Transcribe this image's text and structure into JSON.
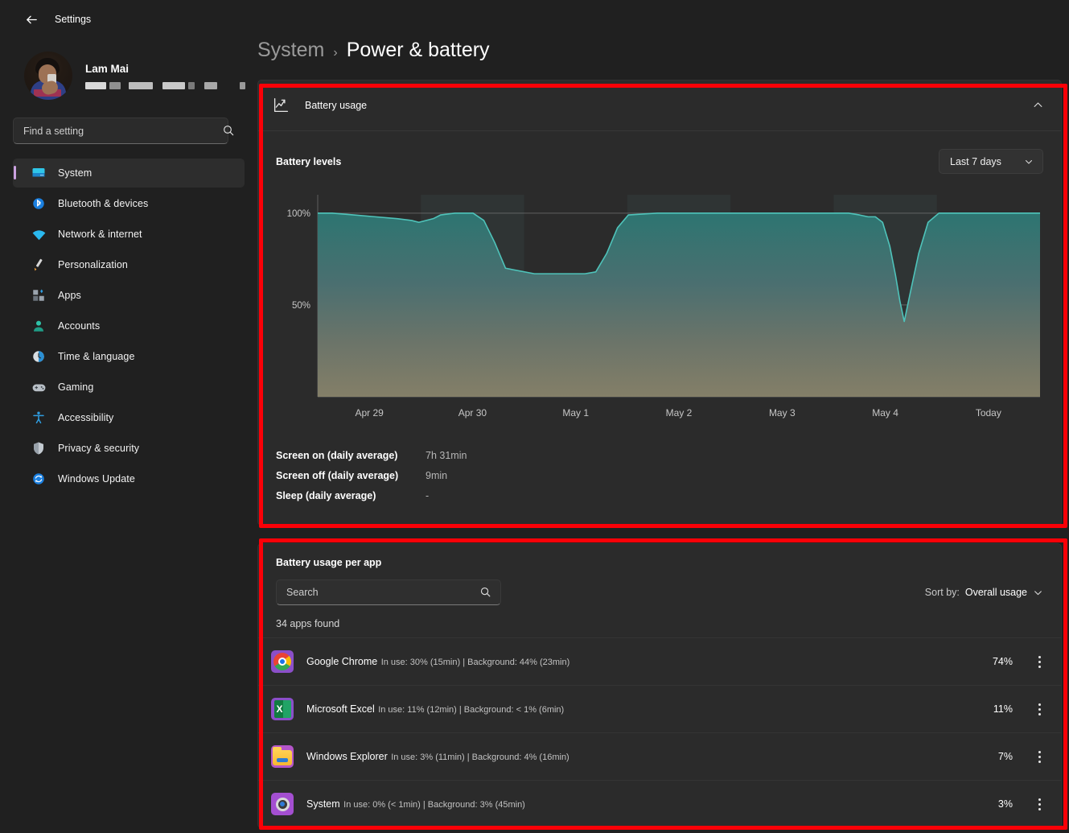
{
  "window": {
    "back_label": "Back",
    "title": "Settings"
  },
  "profile": {
    "name": "Lam Mai",
    "email_redacted": true,
    "avatar_name": "user-avatar"
  },
  "search": {
    "placeholder": "Find a setting",
    "value": "",
    "icon": "search-icon"
  },
  "sidebar": {
    "accent_color": "#cba2e0",
    "items": [
      {
        "label": "System",
        "icon": "monitor-icon",
        "active": true
      },
      {
        "label": "Bluetooth & devices",
        "icon": "bluetooth-icon",
        "active": false
      },
      {
        "label": "Network & internet",
        "icon": "wifi-icon",
        "active": false
      },
      {
        "label": "Personalization",
        "icon": "paintbrush-icon",
        "active": false
      },
      {
        "label": "Apps",
        "icon": "apps-grid-icon",
        "active": false
      },
      {
        "label": "Accounts",
        "icon": "person-icon",
        "active": false
      },
      {
        "label": "Time & language",
        "icon": "clock-icon",
        "active": false
      },
      {
        "label": "Gaming",
        "icon": "gamepad-icon",
        "active": false
      },
      {
        "label": "Accessibility",
        "icon": "accessibility-icon",
        "active": false
      },
      {
        "label": "Privacy & security",
        "icon": "shield-icon",
        "active": false
      },
      {
        "label": "Windows Update",
        "icon": "update-refresh-icon",
        "active": false
      }
    ]
  },
  "breadcrumb": {
    "root": "System",
    "separator": "›",
    "current": "Power & battery"
  },
  "battery_usage_card": {
    "header_title": "Battery usage",
    "header_icon": "line-chart-icon",
    "collapse_icon": "chevron-up-icon",
    "expanded": true,
    "levels_title": "Battery levels",
    "range_select": {
      "value": "Last 7 days",
      "icon": "chevron-down-icon"
    },
    "stats": [
      {
        "label": "Screen on (daily average)",
        "value": "7h 31min"
      },
      {
        "label": "Screen off (daily average)",
        "value": "9min"
      },
      {
        "label": "Sleep (daily average)",
        "value": "-"
      }
    ]
  },
  "chart_data": {
    "type": "area",
    "title": "Battery levels",
    "xlabel": "",
    "ylabel": "",
    "ylim": [
      0,
      110
    ],
    "ytick_labels": [
      "100%",
      "50%"
    ],
    "ytick_values": [
      100,
      50
    ],
    "grid": true,
    "legend_position": "none",
    "categories": [
      "Apr 29",
      "Apr 30",
      "May 1",
      "May 2",
      "May 3",
      "May 4",
      "Today"
    ],
    "line_color": "#3fb6ad",
    "fill_top_color": "#2d6e68",
    "fill_bottom_color": "#7d7a65",
    "band_color": "#2f3434",
    "series": [
      {
        "name": "Battery level",
        "x": [
          0.0,
          0.02,
          0.05,
          0.08,
          0.11,
          0.13,
          0.14,
          0.16,
          0.17,
          0.19,
          0.2,
          0.215,
          0.23,
          0.245,
          0.26,
          0.3,
          0.34,
          0.37,
          0.385,
          0.4,
          0.415,
          0.43,
          0.47,
          0.55,
          0.62,
          0.7,
          0.735,
          0.75,
          0.762,
          0.772,
          0.782,
          0.792,
          0.8,
          0.806,
          0.812,
          0.82,
          0.832,
          0.845,
          0.86,
          0.9,
          0.95,
          1.0
        ],
        "values": [
          100,
          100,
          99,
          98,
          97,
          96,
          95,
          97,
          99,
          100,
          100,
          100,
          96,
          84,
          70,
          67,
          67,
          67,
          68,
          78,
          92,
          99,
          100,
          100,
          100,
          100,
          100,
          99,
          98,
          98,
          95,
          82,
          66,
          52,
          41,
          56,
          78,
          95,
          100,
          100,
          100,
          100
        ]
      }
    ],
    "annotations": []
  },
  "apps_card": {
    "title": "Battery usage per app",
    "search": {
      "placeholder": "Search",
      "value": "",
      "icon": "search-icon"
    },
    "sort": {
      "label": "Sort by:",
      "value": "Overall usage",
      "icon": "chevron-down-icon"
    },
    "count_text": "34 apps found",
    "rows": [
      {
        "name": "Google Chrome",
        "detail": "In use: 30% (15min) | Background: 44% (23min)",
        "percent": "74%",
        "icon": "chrome-icon",
        "menu_icon": "more-vertical-icon"
      },
      {
        "name": "Microsoft Excel",
        "detail": "In use: 11% (12min) | Background: < 1% (6min)",
        "percent": "11%",
        "icon": "excel-icon",
        "menu_icon": "more-vertical-icon"
      },
      {
        "name": "Windows Explorer",
        "detail": "In use: 3% (11min) | Background: 4% (16min)",
        "percent": "7%",
        "icon": "folder-icon",
        "menu_icon": "more-vertical-icon"
      },
      {
        "name": "System",
        "detail": "In use: 0% (< 1min) | Background: 3% (45min)",
        "percent": "3%",
        "icon": "system-gear-icon",
        "menu_icon": "more-vertical-icon"
      }
    ]
  },
  "annotations": {
    "color": "#fb0007",
    "boxes": [
      {
        "name": "battery-usage-highlight"
      },
      {
        "name": "battery-usage-per-app-highlight"
      }
    ]
  }
}
